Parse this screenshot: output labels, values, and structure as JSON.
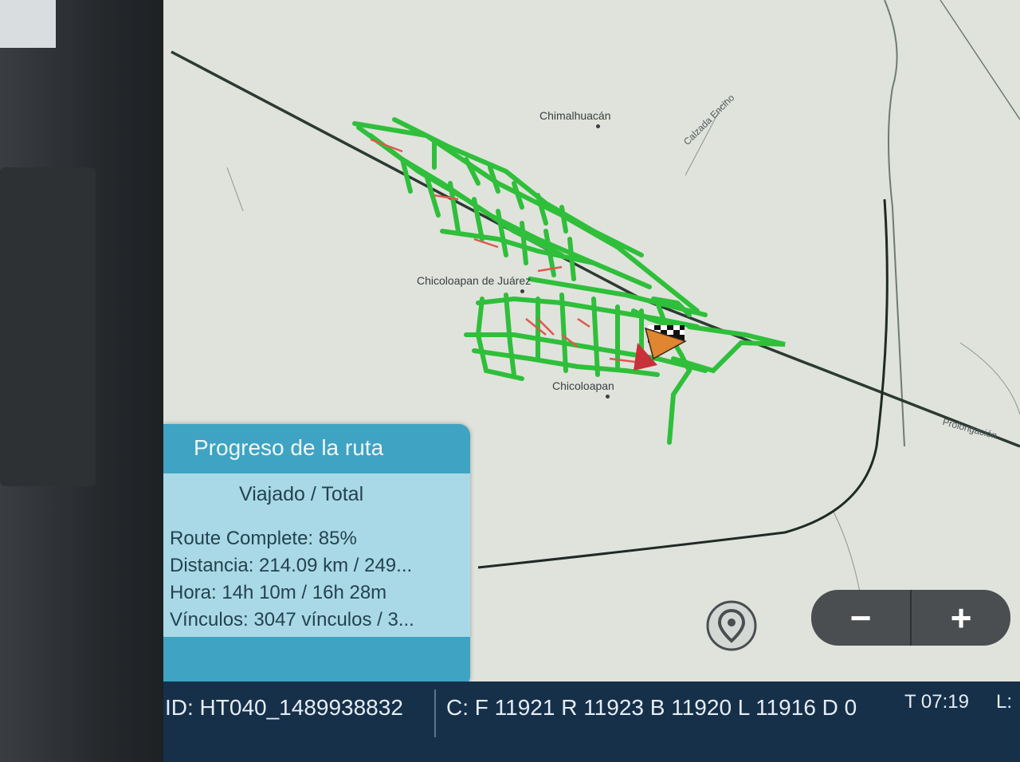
{
  "map": {
    "places": {
      "chimalhuacan": "Chimalhuacán",
      "chicoloapan_juarez": "Chicoloapan de Juárez",
      "chicoloapan": "Chicoloapan"
    },
    "roads": {
      "calzada": "Calzada Encino",
      "prolongacion": "Prolongación"
    },
    "colors": {
      "background": "#dfe3dc",
      "traveled_route": "#2fbf3a",
      "pending_route": "#e0574e",
      "main_road": "#2b3a33"
    }
  },
  "progress_panel": {
    "title": "Progreso de la ruta",
    "subtitle": "Viajado / Total",
    "route_complete": "Route Complete: 85%",
    "distance": "Distancia: 214.09 km / 249...",
    "time": "Hora: 14h 10m / 16h 28m",
    "links": "Vínculos: 3047 vínculos / 3..."
  },
  "controls": {
    "locate_icon": "map-pin-icon",
    "zoom_out": "−",
    "zoom_in": "+"
  },
  "statusbar": {
    "id": "ID: HT040_1489938832",
    "counts": "C: F 11921 R 11923 B 11920 L 11916 D 0",
    "time": "T 07:19",
    "extra": "L:"
  }
}
